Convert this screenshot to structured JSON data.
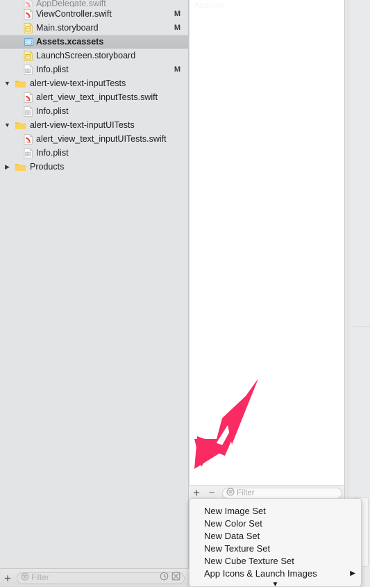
{
  "app": {
    "accent_pink": "#fa2a62",
    "sidebar_bg": "#e2e4e6",
    "selection_bg": "#c6c8ca"
  },
  "navigator": {
    "files": [
      {
        "name": "AppDelegate.swift",
        "icon": "swift-file-icon",
        "indent": 1,
        "twisty": "",
        "flag": "",
        "clipped": true
      },
      {
        "name": "ViewController.swift",
        "icon": "swift-file-icon",
        "indent": 1,
        "twisty": "",
        "flag": "M",
        "selected": false
      },
      {
        "name": "Main.storyboard",
        "icon": "storyboard-file-icon",
        "indent": 1,
        "twisty": "",
        "flag": "M",
        "selected": false
      },
      {
        "name": "Assets.xcassets",
        "icon": "xcassets-file-icon",
        "indent": 1,
        "twisty": "",
        "flag": "",
        "selected": true
      },
      {
        "name": "LaunchScreen.storyboard",
        "icon": "storyboard-file-icon",
        "indent": 1,
        "twisty": "",
        "flag": "",
        "selected": false
      },
      {
        "name": "Info.plist",
        "icon": "plist-file-icon",
        "indent": 1,
        "twisty": "",
        "flag": "M",
        "selected": false
      },
      {
        "name": "alert-view-text-inputTests",
        "icon": "folder-icon",
        "indent": 0,
        "twisty": "expanded",
        "flag": "",
        "selected": false
      },
      {
        "name": "alert_view_text_inputTests.swift",
        "icon": "swift-file-icon",
        "indent": 1,
        "twisty": "",
        "flag": "",
        "selected": false
      },
      {
        "name": "Info.plist",
        "icon": "plist-file-icon",
        "indent": 1,
        "twisty": "",
        "flag": "",
        "selected": false
      },
      {
        "name": "alert-view-text-inputUITests",
        "icon": "folder-icon",
        "indent": 0,
        "twisty": "expanded",
        "flag": "",
        "selected": false
      },
      {
        "name": "alert_view_text_inputUITests.swift",
        "icon": "swift-file-icon",
        "indent": 1,
        "twisty": "",
        "flag": "",
        "selected": false
      },
      {
        "name": "Info.plist",
        "icon": "plist-file-icon",
        "indent": 1,
        "twisty": "",
        "flag": "",
        "selected": false
      },
      {
        "name": "Products",
        "icon": "folder-icon",
        "indent": 0,
        "twisty": "collapsed",
        "flag": "",
        "selected": false
      }
    ],
    "bottom_bar": {
      "add_label": "+",
      "filter_placeholder": "Filter",
      "filter_value": "",
      "recent_icon": "clock-icon",
      "source_control_icon": "filtered-files-icon"
    }
  },
  "asset_editor": {
    "ghost_title": "AppIcon",
    "toolbar": {
      "add_label": "+",
      "remove_label": "−",
      "filter_placeholder": "Filter",
      "filter_value": ""
    }
  },
  "popup_menu": {
    "items": [
      {
        "label": "New Image Set",
        "submenu": false
      },
      {
        "label": "New Color Set",
        "submenu": false
      },
      {
        "label": "New Data Set",
        "submenu": false
      },
      {
        "label": "New Texture Set",
        "submenu": false
      },
      {
        "label": "New Cube Texture Set",
        "submenu": false
      },
      {
        "label": "App Icons & Launch Images",
        "submenu": true,
        "submenu_glyph": "▶"
      }
    ],
    "scroll_down_glyph": "▼"
  },
  "annotation": {
    "type": "arrow",
    "color": "#fa2a62",
    "points_to": "add-asset-button"
  }
}
